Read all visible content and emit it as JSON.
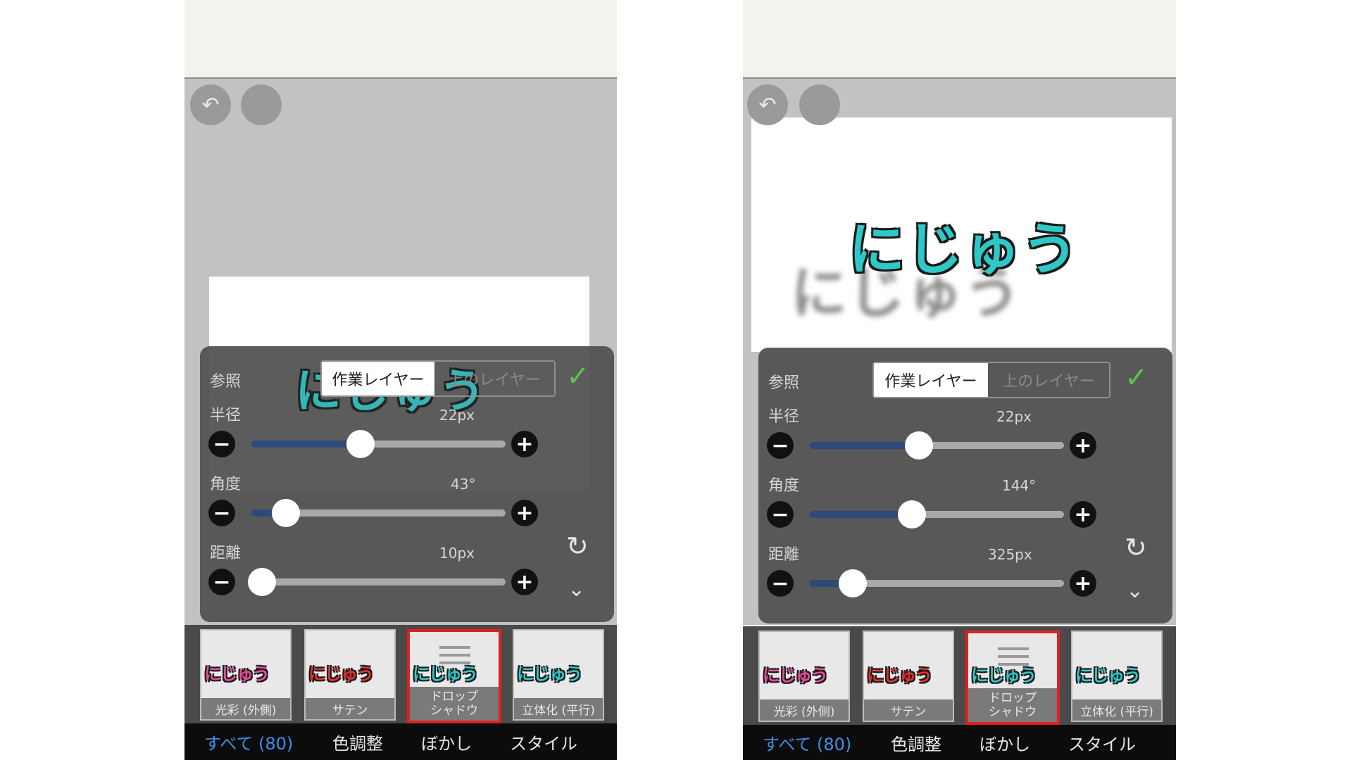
{
  "screens": [
    {
      "canvas_text": "にじゅう",
      "reference": {
        "label": "参照",
        "options": [
          "作業レイヤー",
          "上のレイヤー"
        ],
        "selected": "作業レイヤー"
      },
      "radius": {
        "label": "半径",
        "value": "22px",
        "level": 0.43
      },
      "angle": {
        "label": "角度",
        "value": "43°",
        "level": 0.14
      },
      "distance": {
        "label": "距離",
        "value": "10px",
        "level": 0.02
      },
      "effects": [
        {
          "preview": "にじゅう",
          "label": "光彩 (外側)"
        },
        {
          "preview": "にじゅう",
          "label": "サテン"
        },
        {
          "preview": "にじゅう",
          "label": "ドロップ\nシャドウ",
          "line1": "ドロップ",
          "line2": "シャドウ"
        },
        {
          "preview": "にじゅう",
          "label": "立体化 (平行)"
        }
      ],
      "tabs": [
        "すべて (80)",
        "色調整",
        "ぼかし",
        "スタイル"
      ]
    },
    {
      "canvas_text": "にじゅう",
      "shadow_text": "にじゅう",
      "reference": {
        "label": "参照",
        "options": [
          "作業レイヤー",
          "上のレイヤー"
        ],
        "selected": "作業レイヤー"
      },
      "radius": {
        "label": "半径",
        "value": "22px",
        "level": 0.43
      },
      "angle": {
        "label": "角度",
        "value": "144°",
        "level": 0.4
      },
      "distance": {
        "label": "距離",
        "value": "325px",
        "level": 0.17
      },
      "effects": [
        {
          "preview": "にじゅう",
          "label": "光彩 (外側)"
        },
        {
          "preview": "にじゅう",
          "label": "サテン"
        },
        {
          "preview": "にじゅう",
          "label": "ドロップ\nシャドウ",
          "line1": "ドロップ",
          "line2": "シャドウ"
        },
        {
          "preview": "にじゅう",
          "label": "立体化 (平行)"
        }
      ],
      "tabs": [
        "すべて (80)",
        "色調整",
        "ぼかし",
        "スタイル"
      ]
    }
  ],
  "colors": {
    "accent_blue": "#3f8fe6",
    "selected_border": "#e02020",
    "check_green": "#5cc44c",
    "slider_fill": "#2d4a78"
  },
  "icons": {
    "undo": "undo-icon",
    "confirm": "check-icon",
    "reset": "reset-icon",
    "collapse": "chevron-down-icon"
  }
}
